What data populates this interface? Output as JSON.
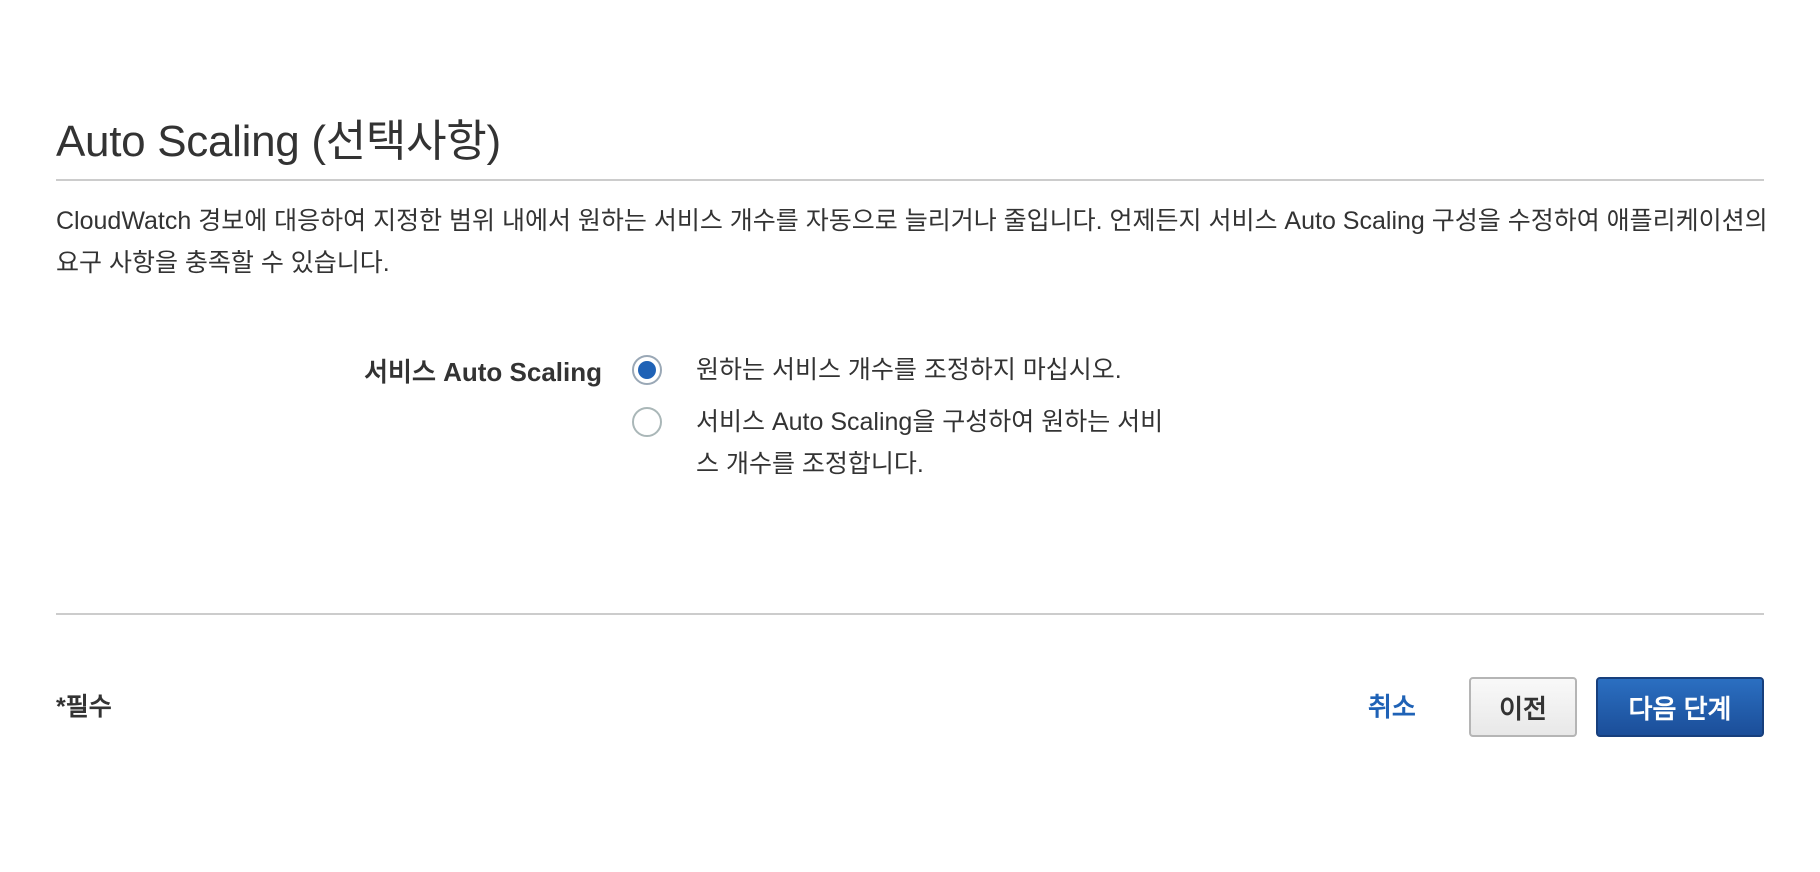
{
  "section": {
    "title": "Auto Scaling (선택사항)",
    "description": "CloudWatch 경보에 대응하여 지정한 범위 내에서 원하는 서비스 개수를 자동으로 늘리거나 줄입니다. 언제든지 서비스 Auto Scaling 구성을 수정하여 애플리케이션의 요구 사항을 충족할 수 있습니다."
  },
  "auto_scaling_field": {
    "label": "서비스 Auto Scaling",
    "options": [
      {
        "label": "원하는 서비스 개수를 조정하지 마십시오.",
        "selected": true
      },
      {
        "label": "서비스 Auto Scaling을 구성하여 원하는 서비스 개수를 조정합니다.",
        "selected": false
      }
    ]
  },
  "footer": {
    "required_note": "*필수",
    "cancel_label": "취소",
    "previous_label": "이전",
    "next_label": "다음 단계"
  },
  "colors": {
    "accent": "#1f62b6",
    "text": "#333333",
    "rule": "#cccccc"
  }
}
